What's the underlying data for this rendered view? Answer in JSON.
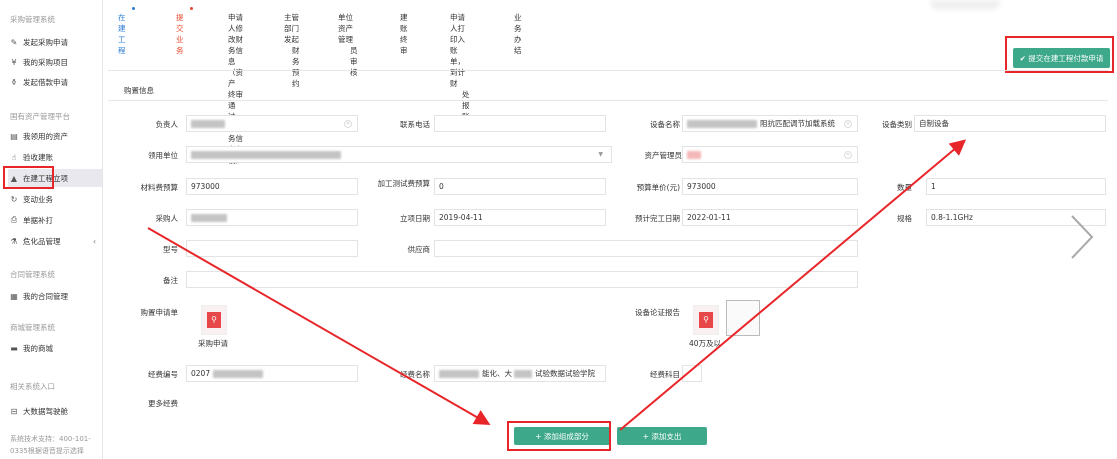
{
  "sidebar": {
    "sec_purchase": "采购管理系统",
    "item_apply": "发起采购申请",
    "item_my_projects": "我的采购项目",
    "item_loan": "发起借款申请",
    "sec_asset": "国有资产管理平台",
    "item_my_assets": "我领用的资产",
    "item_acceptance": "验收建账",
    "item_construction": "在建工程立项",
    "item_change": "变动业务",
    "item_print": "单据补打",
    "item_hazard": "危化品管理",
    "sec_contract": "合同管理系统",
    "item_my_contract": "我的合同管理",
    "sec_mall": "商城管理系统",
    "item_my_mall": "我的商城",
    "sec_links": "相关系统入口",
    "item_bigdata": "大数据驾驶舱",
    "footer_1": "系统技术支持：400-101-",
    "footer_2": "0335根据语音提示选择"
  },
  "tabs": {
    "t1": "在建工程",
    "t2": "提交业务",
    "t3a": "申请人修改财",
    "t3b": "务信息（资产",
    "t3c": "终审通过，财",
    "t3d": "务信息有误）",
    "t4a": "主管部门发起",
    "t4b": "财务预约",
    "t5a": "单位资产管理",
    "t5b": "员审核",
    "t6": "建账终审",
    "t7a": "申请人打印入",
    "t7b": "账单，到计财",
    "t7c": "处报账",
    "t8": "业务办结"
  },
  "submit_button": "✔ 提交在建工程付款申请",
  "section_title": "购置信息",
  "form": {
    "owner_label": "负责人",
    "phone_label": "联系电话",
    "device_name_label": "设备名称",
    "device_name_value": "阻抗匹配调节加载系统",
    "category_label": "设备类别",
    "category_value": "自制设备",
    "unit_label": "领用单位",
    "asset_mgr_label": "资产管理员",
    "material_budget_label": "材料费预算",
    "material_budget_value": "973000",
    "processing_budget_label": "加工测试费预算",
    "processing_budget_value": "0",
    "unit_price_label": "预算单价(元)",
    "unit_price_value": "973000",
    "quantity_label": "数量",
    "quantity_value": "1",
    "buyer_label": "采购人",
    "approval_date_label": "立项日期",
    "approval_date_value": "2019-04-11",
    "finish_date_label": "预计完工日期",
    "finish_date_value": "2022-01-11",
    "spec_label": "规格",
    "spec_value": "0.8-1.1GHz",
    "model_label": "型号",
    "supplier_label": "供应商",
    "remark_label": "备注",
    "purchase_form_label": "购置申请单",
    "purchase_doc_caption": "采购申请",
    "report_label": "设备论证报告",
    "report_caption": "40万及以",
    "fund_code_label": "经费编号",
    "fund_code_value": "0207",
    "fund_name_label": "经费名称",
    "fund_name_mid": "能化、大",
    "fund_name_end": "试验数据试验学院",
    "fund_subject_label": "经费科目",
    "more_funds_label": "更多经费"
  },
  "buttons": {
    "add_component": "+ 添加组成部分",
    "add_expense": "+ 添加支出"
  },
  "colors": {
    "accent_green": "#3da88a",
    "highlight_red": "#e8262a",
    "tab_blue": "#2b7bd6",
    "tab_red": "#e64a2e"
  }
}
